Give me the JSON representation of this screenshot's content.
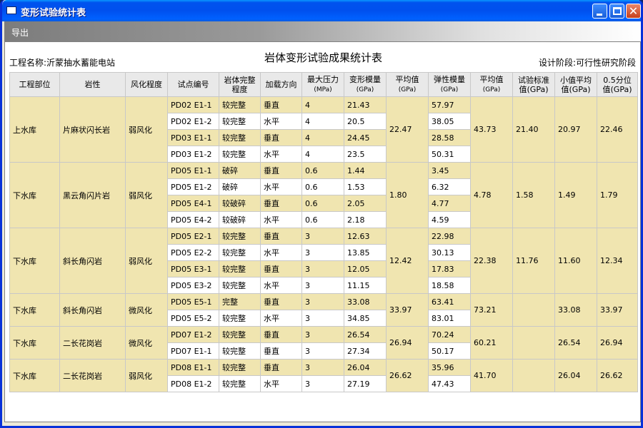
{
  "window": {
    "title": "变形试验统计表"
  },
  "menu": {
    "export": "导出"
  },
  "report": {
    "project_name": "工程名称:沂蒙抽水蓄能电站",
    "title": "岩体变形试验成果统计表",
    "design_stage": "设计阶段:可行性研究阶段"
  },
  "columns": [
    "工程部位",
    "岩性",
    "风化程度",
    "试点编号",
    "岩体完整\n程度",
    "加载方向",
    "最大压力\n(MPa)",
    "变形模量\n(GPa)",
    "平均值\n(GPa)",
    "弹性模量\n(GPa)",
    "平均值\n(GPa)",
    "试验标准\n值(GPa)",
    "小值平均\n值(GPa)",
    "0.5分位\n值(GPa)"
  ],
  "groups": [
    {
      "location": "上水库",
      "rock": "片麻状闪长岩",
      "weathering": "弱风化",
      "def_avg": "22.47",
      "ela_avg": "43.73",
      "std": "21.40",
      "min_avg": "20.97",
      "q05": "22.46",
      "rows": [
        {
          "id": "PD02 E1-1",
          "integrity": "较完整",
          "dir": "垂直",
          "pmax": "4",
          "def": "21.43",
          "ela": "57.97"
        },
        {
          "id": "PD02 E1-2",
          "integrity": "较完整",
          "dir": "水平",
          "pmax": "4",
          "def": "20.5",
          "ela": "38.05"
        },
        {
          "id": "PD03 E1-1",
          "integrity": "较完整",
          "dir": "垂直",
          "pmax": "4",
          "def": "24.45",
          "ela": "28.58"
        },
        {
          "id": "PD03 E1-2",
          "integrity": "较完整",
          "dir": "水平",
          "pmax": "4",
          "def": "23.5",
          "ela": "50.31"
        }
      ]
    },
    {
      "location": "下水库",
      "rock": "黑云角闪片岩",
      "weathering": "弱风化",
      "def_avg": "1.80",
      "ela_avg": "4.78",
      "std": "1.58",
      "min_avg": "1.49",
      "q05": "1.79",
      "rows": [
        {
          "id": "PD05 E1-1",
          "integrity": "破碎",
          "dir": "垂直",
          "pmax": "0.6",
          "def": "1.44",
          "ela": "3.45"
        },
        {
          "id": "PD05 E1-2",
          "integrity": "破碎",
          "dir": "水平",
          "pmax": "0.6",
          "def": "1.53",
          "ela": "6.32"
        },
        {
          "id": "PD05 E4-1",
          "integrity": "较破碎",
          "dir": "垂直",
          "pmax": "0.6",
          "def": "2.05",
          "ela": "4.77"
        },
        {
          "id": "PD05 E4-2",
          "integrity": "较破碎",
          "dir": "水平",
          "pmax": "0.6",
          "def": "2.18",
          "ela": "4.59"
        }
      ]
    },
    {
      "location": "下水库",
      "rock": "斜长角闪岩",
      "weathering": "弱风化",
      "def_avg": "12.42",
      "ela_avg": "22.38",
      "std": "11.76",
      "min_avg": "11.60",
      "q05": "12.34",
      "rows": [
        {
          "id": "PD05 E2-1",
          "integrity": "较完整",
          "dir": "垂直",
          "pmax": "3",
          "def": "12.63",
          "ela": "22.98"
        },
        {
          "id": "PD05 E2-2",
          "integrity": "较完整",
          "dir": "水平",
          "pmax": "3",
          "def": "13.85",
          "ela": "30.13"
        },
        {
          "id": "PD05 E3-1",
          "integrity": "较完整",
          "dir": "垂直",
          "pmax": "3",
          "def": "12.05",
          "ela": "17.83"
        },
        {
          "id": "PD05 E3-2",
          "integrity": "较完整",
          "dir": "水平",
          "pmax": "3",
          "def": "11.15",
          "ela": "18.58"
        }
      ]
    },
    {
      "location": "下水库",
      "rock": "斜长角闪岩",
      "weathering": "微风化",
      "def_avg": "33.97",
      "ela_avg": "73.21",
      "std": "",
      "min_avg": "33.08",
      "q05": "33.97",
      "rows": [
        {
          "id": "PD05 E5-1",
          "integrity": "完整",
          "dir": "垂直",
          "pmax": "3",
          "def": "33.08",
          "ela": "63.41"
        },
        {
          "id": "PD05 E5-2",
          "integrity": "较完整",
          "dir": "水平",
          "pmax": "3",
          "def": "34.85",
          "ela": "83.01"
        }
      ]
    },
    {
      "location": "下水库",
      "rock": "二长花岗岩",
      "weathering": "微风化",
      "def_avg": "26.94",
      "ela_avg": "60.21",
      "std": "",
      "min_avg": "26.54",
      "q05": "26.94",
      "rows": [
        {
          "id": "PD07 E1-2",
          "integrity": "较完整",
          "dir": "垂直",
          "pmax": "3",
          "def": "26.54",
          "ela": "70.24"
        },
        {
          "id": "PD07 E1-1",
          "integrity": "较完整",
          "dir": "垂直",
          "pmax": "3",
          "def": "27.34",
          "ela": "50.17"
        }
      ]
    },
    {
      "location": "下水库",
      "rock": "二长花岗岩",
      "weathering": "弱风化",
      "def_avg": "26.62",
      "ela_avg": "41.70",
      "std": "",
      "min_avg": "26.04",
      "q05": "26.62",
      "rows": [
        {
          "id": "PD08 E1-1",
          "integrity": "较完整",
          "dir": "垂直",
          "pmax": "3",
          "def": "26.04",
          "ela": "35.96"
        },
        {
          "id": "PD08 E1-2",
          "integrity": "较完整",
          "dir": "水平",
          "pmax": "3",
          "def": "27.19",
          "ela": "47.43"
        }
      ]
    }
  ]
}
